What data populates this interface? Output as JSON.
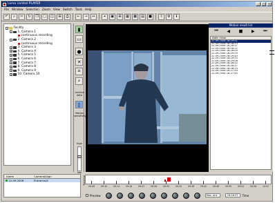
{
  "window": {
    "title": "Lorex control PLAYER"
  },
  "menu": [
    "File",
    "Window",
    "Selection",
    "Zoom",
    "View",
    "Switch",
    "Tools",
    "Help"
  ],
  "tree": {
    "root": "Facility",
    "items": [
      {
        "label": "1. Camera 1",
        "level": 1
      },
      {
        "label": "continuous recording",
        "level": 2,
        "type": "record"
      },
      {
        "label": "2. Camera 2",
        "level": 1
      },
      {
        "label": "continuous recording",
        "level": 2,
        "type": "record"
      },
      {
        "label": "3. Camera 3",
        "level": 1
      },
      {
        "label": "4. Camera 4",
        "level": 1
      },
      {
        "label": "5. Camera 5",
        "level": 1
      },
      {
        "label": "6. Camera 6",
        "level": 1
      },
      {
        "label": "7. Camera 7",
        "level": 1
      },
      {
        "label": "8. Camera 8",
        "level": 1
      },
      {
        "label": "9. Camera 9",
        "level": 1
      },
      {
        "label": "10. Camera 10",
        "level": 1
      }
    ]
  },
  "sidebar": {
    "archive_label": "Archive data",
    "motion_label": "Motion sensitivity",
    "high_label": "high",
    "low_label": "low",
    "light_label": "light"
  },
  "right_panel": {
    "title": "Motion result list",
    "column_header": "Date / time",
    "rows": [
      "22.09.2006  16:29:51",
      "22.09.2006  16:28:53",
      "22.09.2006  16:28:37",
      "22.09.2006  16:28:12",
      "22.09.2006  16:28:00",
      "22.09.2006  16:29:59",
      "22.09.2006  16:29:50",
      "22.09.2006  16:29:25",
      "22.09.2006  16:29:08",
      "22.09.2006  16:28:52",
      "22.09.2006  16:28:37",
      "22.09.2006  16:28:14",
      "22.09.2006  16:27:59",
      "22.09.2006  16:27:45"
    ],
    "selected_index": 0
  },
  "events": {
    "columns": [
      "Alarm",
      "Camera/Align"
    ],
    "rows": [
      {
        "date": "22.09.2006",
        "name": "Entrance/4"
      }
    ]
  },
  "timeline": {
    "label": "Timeline",
    "ticks": [
      "09:06",
      "09:10",
      "09:14",
      "09:18",
      "09:22",
      "09:26",
      "09:30",
      "09:34",
      "09:38",
      "09:42",
      "09:46",
      "09:50",
      "09:54",
      "09:58",
      "10:02"
    ],
    "marker_position": 0.44
  },
  "controls": {
    "preview_label": "Preview",
    "speed_value": "Max. Ant.",
    "time_value": "16:28:37",
    "time_label": "Time"
  },
  "colors": {
    "title_bar": "#0a246a",
    "selection": "#0a246a",
    "alarm_marker": "#d00000"
  }
}
